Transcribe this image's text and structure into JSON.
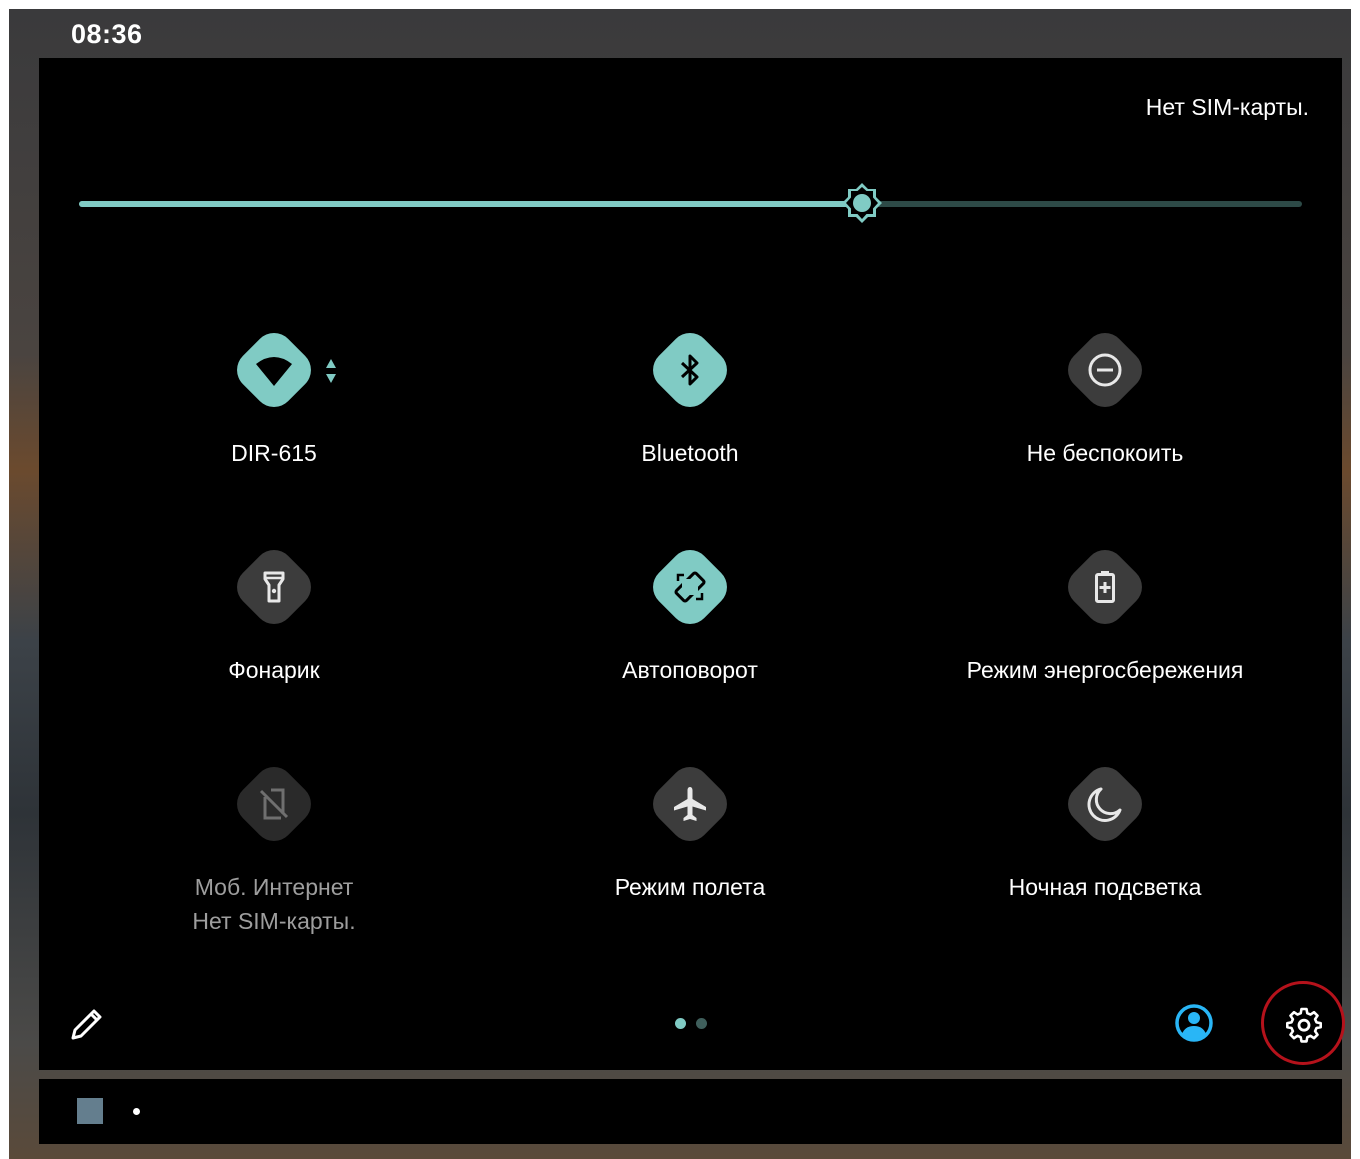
{
  "status_bar": {
    "time": "08:36"
  },
  "quick_settings": {
    "sim_status": "Нет SIM-карты.",
    "brightness_level": 0.64,
    "tiles": [
      {
        "id": "wifi",
        "label": "DIR-615",
        "state": "on",
        "icon": "wifi-icon"
      },
      {
        "id": "bluetooth",
        "label": "Bluetooth",
        "state": "on",
        "icon": "bluetooth-icon"
      },
      {
        "id": "dnd",
        "label": "Не беспокоить",
        "state": "off",
        "icon": "do-not-disturb-icon"
      },
      {
        "id": "flashlight",
        "label": "Фонарик",
        "state": "off",
        "icon": "flashlight-icon"
      },
      {
        "id": "autorotate",
        "label": "Автоповорот",
        "state": "on",
        "icon": "auto-rotate-icon"
      },
      {
        "id": "battery_saver",
        "label": "Режим энергосбережения",
        "state": "off",
        "icon": "battery-saver-icon"
      },
      {
        "id": "mobile_data",
        "label": "Моб. Интернет",
        "sublabel": "Нет SIM-карты.",
        "state": "disabled",
        "icon": "no-sim-icon"
      },
      {
        "id": "airplane",
        "label": "Режим полета",
        "state": "off",
        "icon": "airplane-icon"
      },
      {
        "id": "night_light",
        "label": "Ночная подсветка",
        "state": "off",
        "icon": "night-light-icon"
      }
    ],
    "footer": {
      "page_count": 2,
      "current_page": 1,
      "edit_icon": "pencil-icon",
      "user_icon": "user-account-icon",
      "settings_icon": "gear-icon"
    }
  },
  "colors": {
    "accent": "#80cbc4",
    "tile_off": "#3c3c3c",
    "user_icon": "#29b6f6",
    "highlight": "#b5121b"
  }
}
